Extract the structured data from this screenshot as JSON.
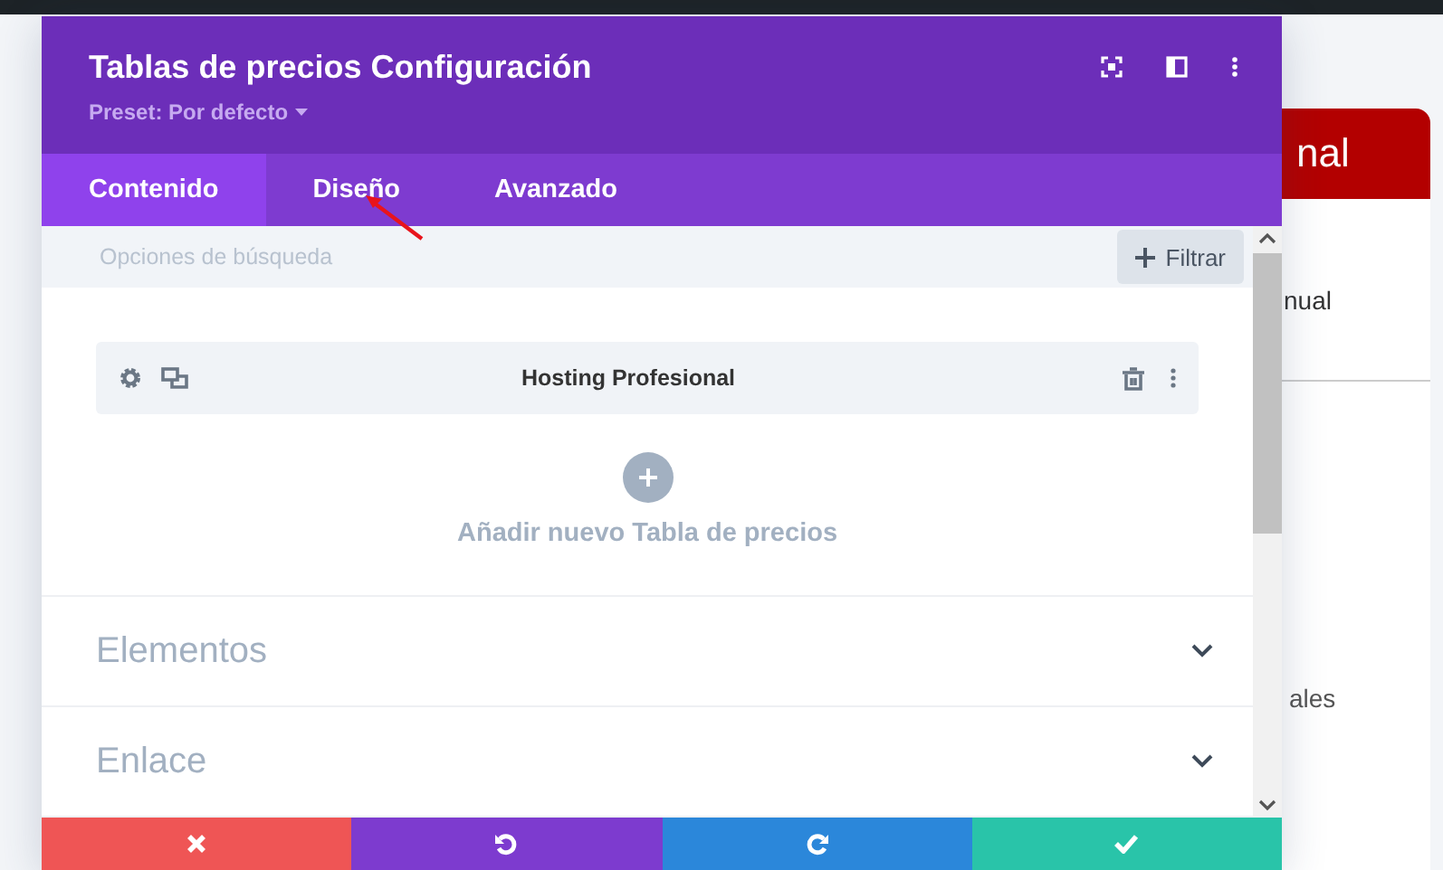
{
  "background_page": {
    "card_heading": "nal",
    "texts": [
      "nual",
      "ales"
    ]
  },
  "modal": {
    "title": "Tablas de precios Configuración",
    "preset": "Preset: Por defecto",
    "tabs": [
      {
        "label": "Contenido",
        "selected": true
      },
      {
        "label": "Diseño",
        "selected": false
      },
      {
        "label": "Avanzado",
        "selected": false
      }
    ],
    "search": {
      "placeholder": "Opciones de búsqueda"
    },
    "filter_button": "Filtrar",
    "items": [
      {
        "label": "Hosting Profesional"
      }
    ],
    "add_label": "Añadir nuevo Tabla de precios",
    "sections": [
      {
        "label": "Elementos"
      },
      {
        "label": "Enlace"
      }
    ],
    "footer_buttons": [
      {
        "kind": "cancel"
      },
      {
        "kind": "undo"
      },
      {
        "kind": "redo"
      },
      {
        "kind": "save"
      }
    ]
  }
}
